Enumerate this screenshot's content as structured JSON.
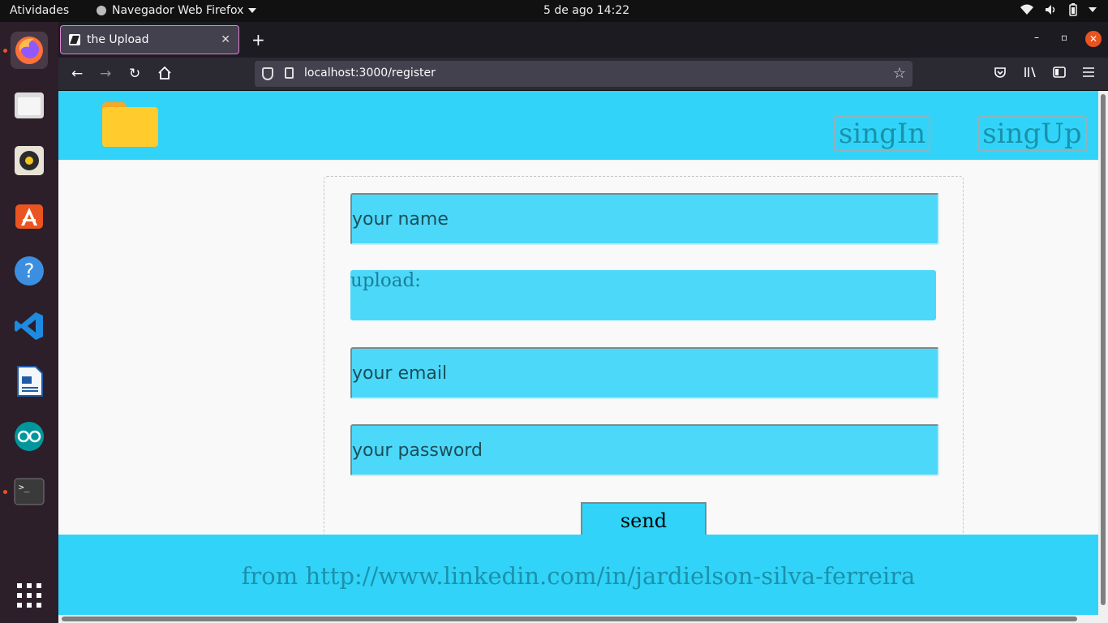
{
  "topbar": {
    "activities": "Atividades",
    "app_name": "Navegador Web Firefox",
    "clock": "5 de ago  14:22"
  },
  "browser": {
    "tab_title": "the Upload",
    "url": "localhost:3000/register"
  },
  "header": {
    "signin_label": "singIn",
    "signup_label": "singUp"
  },
  "form": {
    "name_placeholder": "your name",
    "upload_label": "upload:",
    "email_placeholder": "your email",
    "password_placeholder": "your password",
    "send_label": "send"
  },
  "footer": {
    "credit": "from http://www.linkedin.com/in/jardielson-silva-ferreira"
  },
  "colors": {
    "brand": "#31d4f8",
    "input_bg": "#4cd8f9",
    "text_accent": "#1b91ab"
  }
}
